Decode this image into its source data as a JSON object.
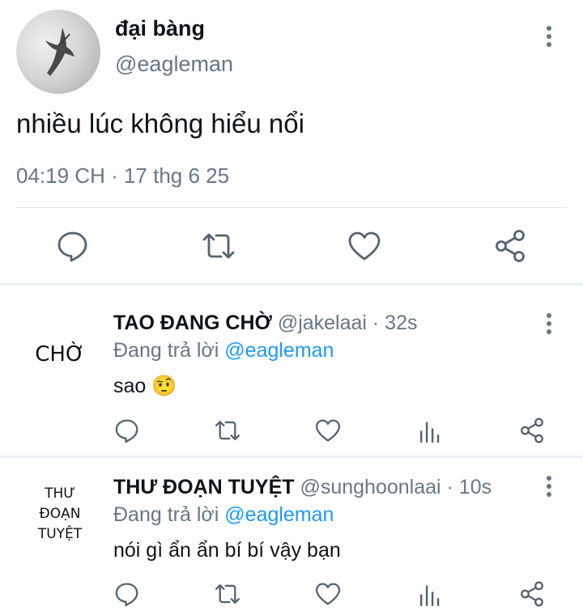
{
  "main_tweet": {
    "author_name": "đại bàng",
    "author_handle": "@eagleman",
    "text": "nhiều lúc không hiểu nổi",
    "timestamp": "04:19 CH · 17 thg 6 25",
    "icons": [
      "comment-icon",
      "retweet-icon",
      "like-icon",
      "share-icon",
      "more-icon"
    ]
  },
  "replies": [
    {
      "avatar_text": "CHỜ",
      "author_name": "TAO ĐANG CHỜ",
      "author_handle": "@jakelaai",
      "time": " · 32s",
      "reply_prefix": "Đang trả lời ",
      "reply_to": "@eagleman",
      "text": "sao",
      "emoji": "🤨"
    },
    {
      "avatar_lines": [
        "THƯ",
        "ĐOẠN",
        "TUYỆT"
      ],
      "author_name": "THƯ ĐOẠN TUYỆT",
      "author_handle": "@sunghoonlaai",
      "time": " · 10s",
      "reply_prefix": "Đang trả lời ",
      "reply_to": "@eagleman",
      "text": "nói gì ẩn ẩn bí bí vậy bạn"
    }
  ],
  "colors": {
    "text": "#0f1419",
    "muted": "#667786",
    "link": "#1d9bf0",
    "divider": "#e1e6ea"
  }
}
